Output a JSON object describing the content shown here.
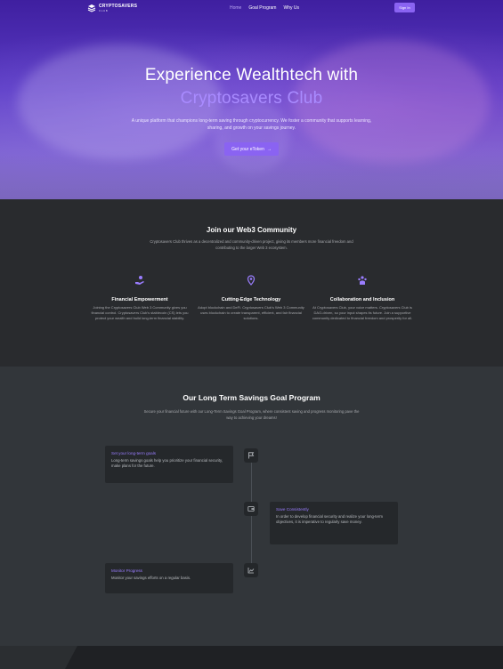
{
  "brand": {
    "name": "CRYPTOSAVERS",
    "sub": "CLUB"
  },
  "nav": {
    "links": [
      "Home",
      "Goal Program",
      "Why Us"
    ],
    "signin": "Sign In"
  },
  "hero": {
    "title_line1": "Experience Wealthtech with",
    "title_line2": "Cryptosavers Club",
    "subtitle": "A unique platform that champions long-term saving through cryptocurrency. We foster a community that supports learning, sharing, and growth on your savings journey.",
    "cta": "Get your eToken",
    "cta_arrow": "→"
  },
  "web3": {
    "title": "Join our Web3 Community",
    "subtitle": "Cryptosavers Club thrives as a decentralized and community-driven project, giving its members more financial freedom and contributing to the larger Web 3 ecosystem.",
    "features": [
      {
        "icon": "hand-coins-icon",
        "title": "Financial Empowerment",
        "desc": "Joining the Cryptosavers Club Web 3 Community gives you financial control. Cryptosavers Club's stablecoin (CS) lets you protect your wealth and build long-term financial stability."
      },
      {
        "icon": "location-pin-icon",
        "title": "Cutting-Edge Technology",
        "desc": "Adopt blockchain and DeFi. Cryptosavers Club's Web 3 Community uses blockchain to create transparent, efficient, and fair financial solutions."
      },
      {
        "icon": "community-icon",
        "title": "Collaboration and Inclusion",
        "desc": "At Cryptosavers Club, your voice matters. Cryptosavers Club is DAO-driven, so your input shapes its future. Join a supportive community dedicated to financial freedom and prosperity for all."
      }
    ]
  },
  "goals": {
    "title": "Our Long Term Savings Goal Program",
    "subtitle": "Secure your financial future with our Long-Term Savings Goal Program, where consistent saving and progress monitoring pave the way to achieving your dreams!",
    "steps": [
      {
        "icon": "flag-icon",
        "title": "Set your long-term goals",
        "desc": "Long-term savings goals help you prioritize your financial security, make plans for the future."
      },
      {
        "icon": "wallet-icon",
        "title": "Save Consistently",
        "desc": "In order to develop financial security and realize your long-term objectives, it is imperative to regularly save money."
      },
      {
        "icon": "chart-icon",
        "title": "Monitor Progress",
        "desc": "Monitor your savings efforts on a regular basis."
      }
    ]
  },
  "colors": {
    "accent": "#8a63f2",
    "accent_text": "#a98bff",
    "dark": "#292b2e",
    "mid": "#32363a"
  }
}
